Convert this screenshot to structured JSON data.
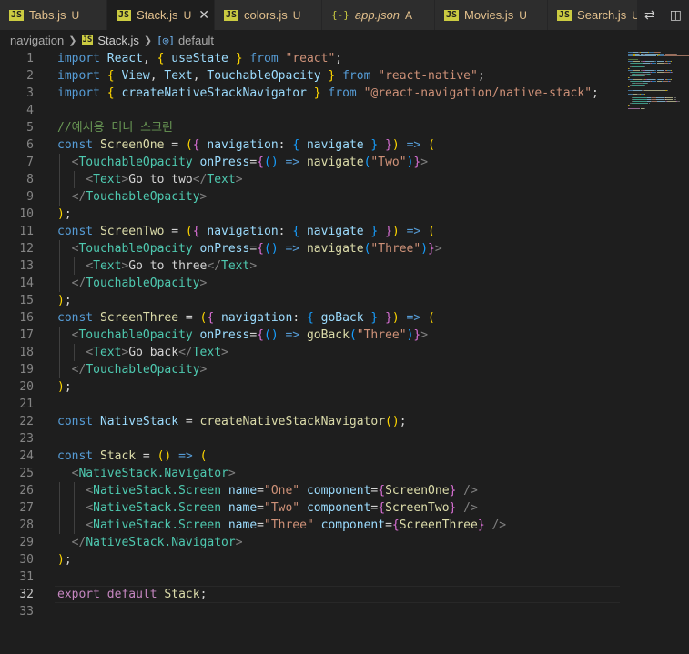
{
  "tabs": [
    {
      "name": "Tabs.js",
      "badge": "U",
      "icon": "js-icon",
      "active": false
    },
    {
      "name": "Stack.js",
      "badge": "U",
      "icon": "js-icon",
      "active": true,
      "close": "✕"
    },
    {
      "name": "colors.js",
      "badge": "U",
      "icon": "js-icon",
      "active": false
    },
    {
      "name": "app.json",
      "badge": "A",
      "icon": "json-icon",
      "active": false
    },
    {
      "name": "Movies.js",
      "badge": "U",
      "icon": "js-icon",
      "active": false
    },
    {
      "name": "Search.js",
      "badge": "U",
      "icon": "js-icon",
      "active": false
    }
  ],
  "tab_icons": {
    "js": "JS",
    "json": "{-}"
  },
  "tab_actions": {
    "compare": "⇄",
    "split": "◫"
  },
  "breadcrumb": {
    "folder": "navigation",
    "file": "Stack.js",
    "symbol": "default",
    "js_icon": "JS",
    "symbol_icon": "[◎]"
  },
  "current_line": 32,
  "code_lines": [
    {
      "n": "1",
      "tokens": [
        [
          "k",
          "import "
        ],
        [
          "id",
          "React"
        ],
        [
          "p",
          ", "
        ],
        [
          "b1",
          "{ "
        ],
        [
          "id",
          "useState"
        ],
        [
          "b1",
          " }"
        ],
        [
          "k",
          " from "
        ],
        [
          "s",
          "\"react\""
        ],
        [
          "p",
          ";"
        ]
      ]
    },
    {
      "n": "2",
      "tokens": [
        [
          "k",
          "import "
        ],
        [
          "b1",
          "{ "
        ],
        [
          "id",
          "View"
        ],
        [
          "p",
          ", "
        ],
        [
          "id",
          "Text"
        ],
        [
          "p",
          ", "
        ],
        [
          "id",
          "TouchableOpacity"
        ],
        [
          "b1",
          " }"
        ],
        [
          "k",
          " from "
        ],
        [
          "s",
          "\"react-native\""
        ],
        [
          "p",
          ";"
        ]
      ]
    },
    {
      "n": "3",
      "tokens": [
        [
          "k",
          "import "
        ],
        [
          "b1",
          "{ "
        ],
        [
          "id",
          "createNativeStackNavigator"
        ],
        [
          "b1",
          " }"
        ],
        [
          "k",
          " from "
        ],
        [
          "s",
          "\"@react-navigation/native-stack\""
        ],
        [
          "p",
          ";"
        ]
      ]
    },
    {
      "n": "4",
      "tokens": []
    },
    {
      "n": "5",
      "tokens": [
        [
          "cm",
          "//예시용 미니 스크린"
        ]
      ]
    },
    {
      "n": "6",
      "tokens": [
        [
          "k",
          "const "
        ],
        [
          "fn",
          "ScreenOne"
        ],
        [
          "p",
          " = "
        ],
        [
          "b1",
          "("
        ],
        [
          "b2",
          "{ "
        ],
        [
          "id",
          "navigation"
        ],
        [
          "p",
          ": "
        ],
        [
          "b3",
          "{ "
        ],
        [
          "id",
          "navigate"
        ],
        [
          "b3",
          " }"
        ],
        [
          "b2",
          " }"
        ],
        [
          "b1",
          ")"
        ],
        [
          "k",
          " => "
        ],
        [
          "b1",
          "("
        ]
      ]
    },
    {
      "n": "7",
      "tokens": [
        [
          "p",
          "  "
        ],
        [
          "tg",
          "<"
        ],
        [
          "t",
          "TouchableOpacity"
        ],
        [
          "at",
          " onPress"
        ],
        [
          "p",
          "="
        ],
        [
          "b2",
          "{"
        ],
        [
          "b3",
          "()"
        ],
        [
          "k",
          " => "
        ],
        [
          "fn",
          "navigate"
        ],
        [
          "b3",
          "("
        ],
        [
          "s",
          "\"Two\""
        ],
        [
          "b3",
          ")"
        ],
        [
          "b2",
          "}"
        ],
        [
          "tg",
          ">"
        ]
      ]
    },
    {
      "n": "8",
      "tokens": [
        [
          "p",
          "    "
        ],
        [
          "tg",
          "<"
        ],
        [
          "t",
          "Text"
        ],
        [
          "tg",
          ">"
        ],
        [
          "p",
          "Go to two"
        ],
        [
          "tg",
          "</"
        ],
        [
          "t",
          "Text"
        ],
        [
          "tg",
          ">"
        ]
      ]
    },
    {
      "n": "9",
      "tokens": [
        [
          "p",
          "  "
        ],
        [
          "tg",
          "</"
        ],
        [
          "t",
          "TouchableOpacity"
        ],
        [
          "tg",
          ">"
        ]
      ]
    },
    {
      "n": "10",
      "tokens": [
        [
          "b1",
          ")"
        ],
        [
          "p",
          ";"
        ]
      ]
    },
    {
      "n": "11",
      "tokens": [
        [
          "k",
          "const "
        ],
        [
          "fn",
          "ScreenTwo"
        ],
        [
          "p",
          " = "
        ],
        [
          "b1",
          "("
        ],
        [
          "b2",
          "{ "
        ],
        [
          "id",
          "navigation"
        ],
        [
          "p",
          ": "
        ],
        [
          "b3",
          "{ "
        ],
        [
          "id",
          "navigate"
        ],
        [
          "b3",
          " }"
        ],
        [
          "b2",
          " }"
        ],
        [
          "b1",
          ")"
        ],
        [
          "k",
          " => "
        ],
        [
          "b1",
          "("
        ]
      ]
    },
    {
      "n": "12",
      "tokens": [
        [
          "p",
          "  "
        ],
        [
          "tg",
          "<"
        ],
        [
          "t",
          "TouchableOpacity"
        ],
        [
          "at",
          " onPress"
        ],
        [
          "p",
          "="
        ],
        [
          "b2",
          "{"
        ],
        [
          "b3",
          "()"
        ],
        [
          "k",
          " => "
        ],
        [
          "fn",
          "navigate"
        ],
        [
          "b3",
          "("
        ],
        [
          "s",
          "\"Three\""
        ],
        [
          "b3",
          ")"
        ],
        [
          "b2",
          "}"
        ],
        [
          "tg",
          ">"
        ]
      ]
    },
    {
      "n": "13",
      "tokens": [
        [
          "p",
          "    "
        ],
        [
          "tg",
          "<"
        ],
        [
          "t",
          "Text"
        ],
        [
          "tg",
          ">"
        ],
        [
          "p",
          "Go to three"
        ],
        [
          "tg",
          "</"
        ],
        [
          "t",
          "Text"
        ],
        [
          "tg",
          ">"
        ]
      ]
    },
    {
      "n": "14",
      "tokens": [
        [
          "p",
          "  "
        ],
        [
          "tg",
          "</"
        ],
        [
          "t",
          "TouchableOpacity"
        ],
        [
          "tg",
          ">"
        ]
      ]
    },
    {
      "n": "15",
      "tokens": [
        [
          "b1",
          ")"
        ],
        [
          "p",
          ";"
        ]
      ]
    },
    {
      "n": "16",
      "tokens": [
        [
          "k",
          "const "
        ],
        [
          "fn",
          "ScreenThree"
        ],
        [
          "p",
          " = "
        ],
        [
          "b1",
          "("
        ],
        [
          "b2",
          "{ "
        ],
        [
          "id",
          "navigation"
        ],
        [
          "p",
          ": "
        ],
        [
          "b3",
          "{ "
        ],
        [
          "id",
          "goBack"
        ],
        [
          "b3",
          " }"
        ],
        [
          "b2",
          " }"
        ],
        [
          "b1",
          ")"
        ],
        [
          "k",
          " => "
        ],
        [
          "b1",
          "("
        ]
      ]
    },
    {
      "n": "17",
      "tokens": [
        [
          "p",
          "  "
        ],
        [
          "tg",
          "<"
        ],
        [
          "t",
          "TouchableOpacity"
        ],
        [
          "at",
          " onPress"
        ],
        [
          "p",
          "="
        ],
        [
          "b2",
          "{"
        ],
        [
          "b3",
          "()"
        ],
        [
          "k",
          " => "
        ],
        [
          "fn",
          "goBack"
        ],
        [
          "b3",
          "("
        ],
        [
          "s",
          "\"Three\""
        ],
        [
          "b3",
          ")"
        ],
        [
          "b2",
          "}"
        ],
        [
          "tg",
          ">"
        ]
      ]
    },
    {
      "n": "18",
      "tokens": [
        [
          "p",
          "    "
        ],
        [
          "tg",
          "<"
        ],
        [
          "t",
          "Text"
        ],
        [
          "tg",
          ">"
        ],
        [
          "p",
          "Go back"
        ],
        [
          "tg",
          "</"
        ],
        [
          "t",
          "Text"
        ],
        [
          "tg",
          ">"
        ]
      ]
    },
    {
      "n": "19",
      "tokens": [
        [
          "p",
          "  "
        ],
        [
          "tg",
          "</"
        ],
        [
          "t",
          "TouchableOpacity"
        ],
        [
          "tg",
          ">"
        ]
      ]
    },
    {
      "n": "20",
      "tokens": [
        [
          "b1",
          ")"
        ],
        [
          "p",
          ";"
        ]
      ]
    },
    {
      "n": "21",
      "tokens": []
    },
    {
      "n": "22",
      "tokens": [
        [
          "k",
          "const "
        ],
        [
          "id",
          "NativeStack"
        ],
        [
          "p",
          " = "
        ],
        [
          "fn",
          "createNativeStackNavigator"
        ],
        [
          "b1",
          "()"
        ],
        [
          "p",
          ";"
        ]
      ]
    },
    {
      "n": "23",
      "tokens": []
    },
    {
      "n": "24",
      "tokens": [
        [
          "k",
          "const "
        ],
        [
          "fn",
          "Stack"
        ],
        [
          "p",
          " = "
        ],
        [
          "b1",
          "()"
        ],
        [
          "k",
          " => "
        ],
        [
          "b1",
          "("
        ]
      ]
    },
    {
      "n": "25",
      "tokens": [
        [
          "p",
          "  "
        ],
        [
          "tg",
          "<"
        ],
        [
          "t",
          "NativeStack.Navigator"
        ],
        [
          "tg",
          ">"
        ]
      ]
    },
    {
      "n": "26",
      "tokens": [
        [
          "p",
          "    "
        ],
        [
          "tg",
          "<"
        ],
        [
          "t",
          "NativeStack.Screen"
        ],
        [
          "at",
          " name"
        ],
        [
          "p",
          "="
        ],
        [
          "s",
          "\"One\""
        ],
        [
          "at",
          " component"
        ],
        [
          "p",
          "="
        ],
        [
          "b2",
          "{"
        ],
        [
          "fn",
          "ScreenOne"
        ],
        [
          "b2",
          "}"
        ],
        [
          "tg",
          " />"
        ]
      ]
    },
    {
      "n": "27",
      "tokens": [
        [
          "p",
          "    "
        ],
        [
          "tg",
          "<"
        ],
        [
          "t",
          "NativeStack.Screen"
        ],
        [
          "at",
          " name"
        ],
        [
          "p",
          "="
        ],
        [
          "s",
          "\"Two\""
        ],
        [
          "at",
          " component"
        ],
        [
          "p",
          "="
        ],
        [
          "b2",
          "{"
        ],
        [
          "fn",
          "ScreenTwo"
        ],
        [
          "b2",
          "}"
        ],
        [
          "tg",
          " />"
        ]
      ]
    },
    {
      "n": "28",
      "tokens": [
        [
          "p",
          "    "
        ],
        [
          "tg",
          "<"
        ],
        [
          "t",
          "NativeStack.Screen"
        ],
        [
          "at",
          " name"
        ],
        [
          "p",
          "="
        ],
        [
          "s",
          "\"Three\""
        ],
        [
          "at",
          " component"
        ],
        [
          "p",
          "="
        ],
        [
          "b2",
          "{"
        ],
        [
          "fn",
          "ScreenThree"
        ],
        [
          "b2",
          "}"
        ],
        [
          "tg",
          " />"
        ]
      ]
    },
    {
      "n": "29",
      "tokens": [
        [
          "p",
          "  "
        ],
        [
          "tg",
          "</"
        ],
        [
          "t",
          "NativeStack.Navigator"
        ],
        [
          "tg",
          ">"
        ]
      ]
    },
    {
      "n": "30",
      "tokens": [
        [
          "b1",
          ")"
        ],
        [
          "p",
          ";"
        ]
      ]
    },
    {
      "n": "31",
      "tokens": []
    },
    {
      "n": "32",
      "tokens": [
        [
          "kc",
          "export "
        ],
        [
          "kc",
          "default "
        ],
        [
          "fn",
          "Stack"
        ],
        [
          "p",
          ";"
        ]
      ]
    },
    {
      "n": "33",
      "tokens": []
    }
  ]
}
